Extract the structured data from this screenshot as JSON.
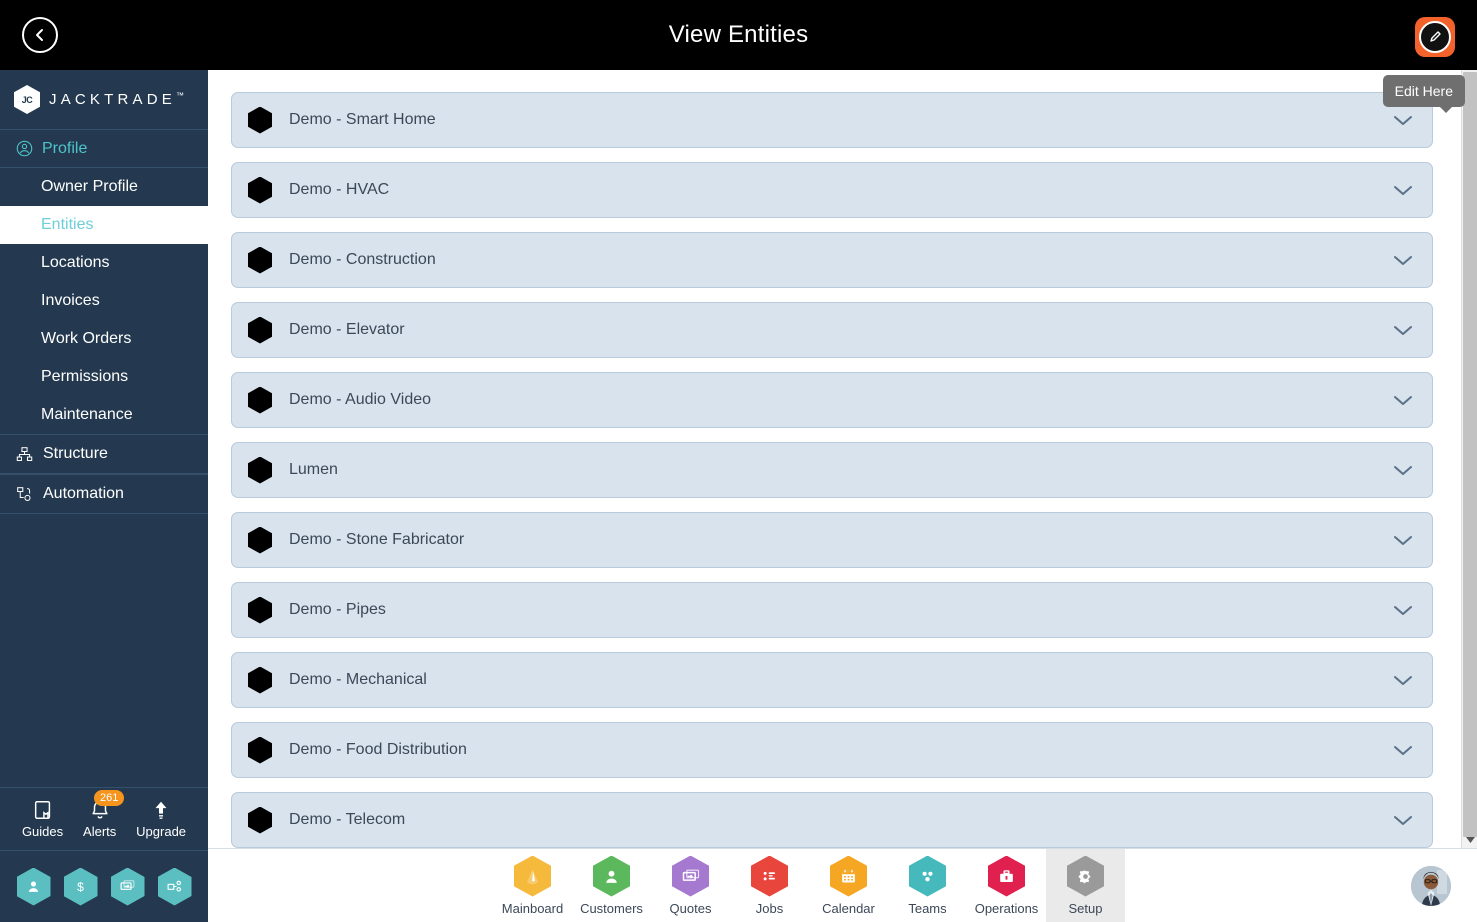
{
  "header": {
    "title": "View Entities",
    "back_icon": "chevron-left-circle-icon",
    "edit_icon": "pencil-icon",
    "tooltip": "Edit Here"
  },
  "sidebar": {
    "brand": "JACKTRADE",
    "brand_tm": "™",
    "brand_mark": "JC",
    "group": {
      "label": "Profile",
      "icon": "user-circle-icon"
    },
    "items": [
      {
        "label": "Owner Profile",
        "active": false
      },
      {
        "label": "Entities",
        "active": true
      },
      {
        "label": "Locations",
        "active": false
      },
      {
        "label": "Invoices",
        "active": false
      },
      {
        "label": "Work Orders",
        "active": false
      },
      {
        "label": "Permissions",
        "active": false
      },
      {
        "label": "Maintenance",
        "active": false
      }
    ],
    "sections": [
      {
        "label": "Structure",
        "icon": "sitemap-icon"
      },
      {
        "label": "Automation",
        "icon": "workflow-icon"
      }
    ],
    "quick": [
      {
        "label": "Guides",
        "icon": "book-icon",
        "badge": ""
      },
      {
        "label": "Alerts",
        "icon": "bell-icon",
        "badge": "261"
      },
      {
        "label": "Upgrade",
        "icon": "up-arrow-icon",
        "badge": ""
      }
    ],
    "hex_shortcuts": [
      {
        "icon": "person-icon"
      },
      {
        "icon": "dollar-icon"
      },
      {
        "icon": "money-exchange-icon"
      },
      {
        "icon": "nodes-icon"
      }
    ],
    "accent": "#4ec3c9",
    "background": "#24394f"
  },
  "entities": [
    {
      "label": "Demo - Smart Home",
      "icon": "hexagon-icon",
      "expand_icon": "chevron-down-icon"
    },
    {
      "label": "Demo - HVAC",
      "icon": "hexagon-icon",
      "expand_icon": "chevron-down-icon"
    },
    {
      "label": "Demo - Construction",
      "icon": "hexagon-icon",
      "expand_icon": "chevron-down-icon"
    },
    {
      "label": "Demo - Elevator",
      "icon": "hexagon-icon",
      "expand_icon": "chevron-down-icon"
    },
    {
      "label": "Demo - Audio Video",
      "icon": "hexagon-icon",
      "expand_icon": "chevron-down-icon"
    },
    {
      "label": "Lumen",
      "icon": "hexagon-icon",
      "expand_icon": "chevron-down-icon"
    },
    {
      "label": "Demo - Stone Fabricator",
      "icon": "hexagon-icon",
      "expand_icon": "chevron-down-icon"
    },
    {
      "label": "Demo - Pipes",
      "icon": "hexagon-icon",
      "expand_icon": "chevron-down-icon"
    },
    {
      "label": "Demo - Mechanical",
      "icon": "hexagon-icon",
      "expand_icon": "chevron-down-icon"
    },
    {
      "label": "Demo - Food Distribution",
      "icon": "hexagon-icon",
      "expand_icon": "chevron-down-icon"
    },
    {
      "label": "Demo - Telecom",
      "icon": "hexagon-icon",
      "expand_icon": "chevron-down-icon"
    }
  ],
  "bottom_nav": {
    "items": [
      {
        "label": "Mainboard",
        "icon": "dashboard-icon",
        "color": "#f5b93c",
        "active": false
      },
      {
        "label": "Customers",
        "icon": "person-icon",
        "color": "#5cb85c",
        "active": false
      },
      {
        "label": "Quotes",
        "icon": "quote-icon",
        "color": "#a579d0",
        "active": false
      },
      {
        "label": "Jobs",
        "icon": "list-icon",
        "color": "#e8453c",
        "active": false
      },
      {
        "label": "Calendar",
        "icon": "calendar-icon",
        "color": "#f5a623",
        "active": false
      },
      {
        "label": "Teams",
        "icon": "teams-icon",
        "color": "#46b9bd",
        "active": false
      },
      {
        "label": "Operations",
        "icon": "briefcase-icon",
        "color": "#e0214f",
        "active": false
      },
      {
        "label": "Setup",
        "icon": "gear-icon",
        "color": "#9a9a9a",
        "active": true
      }
    ],
    "avatar_icon": "user-avatar"
  }
}
